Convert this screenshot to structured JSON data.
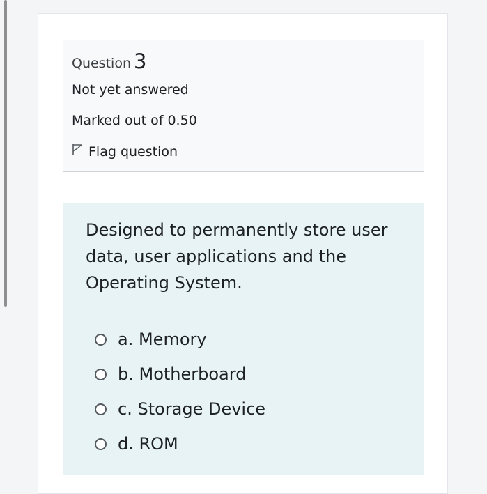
{
  "question_info": {
    "label": "Question",
    "number": "3",
    "state": "Not yet answered",
    "grade": "Marked out of 0.50",
    "flag_label": "Flag question"
  },
  "question": {
    "text": "Designed to permanently store user data, user applications and the Operating System.",
    "answers": [
      {
        "label": "a. Memory"
      },
      {
        "label": "b. Motherboard"
      },
      {
        "label": "c. Storage Device"
      },
      {
        "label": "d. ROM"
      }
    ]
  },
  "colors": {
    "page_bg": "#f4f5f7",
    "info_bg": "#f8f9fa",
    "question_bg": "#e7f3f5",
    "text": "#1d2125"
  },
  "icons": {
    "flag": "flag-outline-icon"
  }
}
